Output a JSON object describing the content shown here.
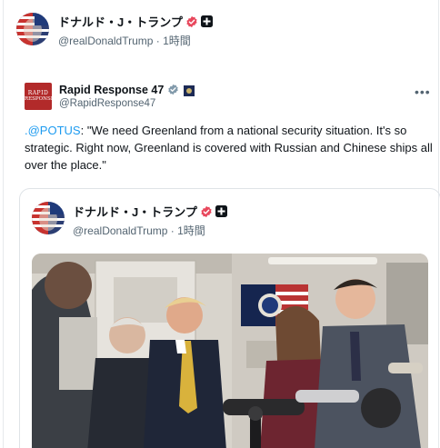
{
  "main_post": {
    "display_name": "ドナルド・J・トランプ",
    "handle": "@realDonaldTrump",
    "time": "1時間",
    "handle_line": "@realDonaldTrump · 1時間"
  },
  "quoted_account": {
    "display_name": "Rapid Response 47",
    "handle": "@RapidResponse47",
    "logo_line1": "RAPID",
    "logo_line2": "RESPONSE"
  },
  "tweet": {
    "mention": ".@POTUS",
    "text": ": \"We need Greenland from a national security situation. It's so strategic. Right now, Greenland is covered with Russian and Chinese ships all over the place.\""
  },
  "inner_post": {
    "display_name": "ドナルド・J・トランプ",
    "handle_line": "@realDonaldTrump · 1時間"
  },
  "icons": {
    "verified": "verified-badge-icon",
    "affiliate": "affiliate-badge-icon",
    "more": "more-icon"
  },
  "colors": {
    "link": "#1d9bf0",
    "verified_gold": "#e8475c",
    "secondary_text": "#536471"
  }
}
